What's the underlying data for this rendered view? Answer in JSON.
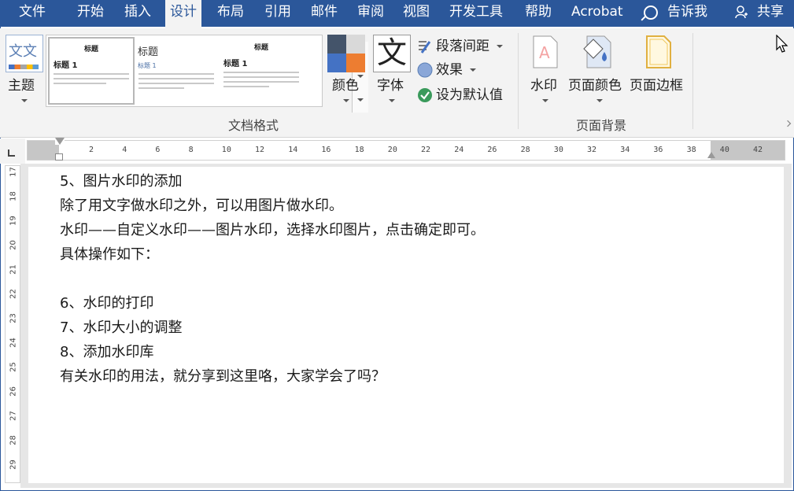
{
  "menubar": {
    "tabs": [
      "文件",
      "开始",
      "插入",
      "设计",
      "布局",
      "引用",
      "邮件",
      "审阅",
      "视图",
      "开发工具",
      "帮助",
      "Acrobat"
    ],
    "active_tab": "设计",
    "tell_me": "告诉我",
    "share": "共享"
  },
  "ribbon": {
    "themes": {
      "label": "主题",
      "icon_text": "文文"
    },
    "gallery": {
      "items": [
        {
          "heading": "标题",
          "title1": "标题 1"
        },
        {
          "big": "标题",
          "sub": "标题 1"
        },
        {
          "heading": "标题",
          "title1": "标题 1"
        }
      ]
    },
    "colors_label": "颜色",
    "font_label": "字体",
    "font_icon_text": "文",
    "paragraph_spacing": "段落间距",
    "effects": "效果",
    "set_default": "设为默认值",
    "document_formatting_group": "文档格式",
    "watermark": "水印",
    "page_color": "页面颜色",
    "page_borders": "页面边框",
    "page_background_group": "页面背景"
  },
  "ruler": {
    "h_ticks": [
      "2",
      "4",
      "6",
      "8",
      "10",
      "12",
      "14",
      "16",
      "18",
      "20",
      "22",
      "24",
      "26",
      "28",
      "30",
      "32",
      "34",
      "36",
      "38",
      "40",
      "42"
    ],
    "v_ticks": [
      "17",
      "18",
      "19",
      "20",
      "21",
      "22",
      "23",
      "24",
      "25",
      "26",
      "27",
      "28",
      "29"
    ]
  },
  "document": {
    "lines": [
      "5、图片水印的添加",
      "除了用文字做水印之外，可以用图片做水印。",
      "水印——自定义水印——图片水印，选择水印图片，点击确定即可。",
      "具体操作如下：",
      "",
      "6、水印的打印",
      "7、水印大小的调整",
      "8、添加水印库",
      "有关水印的用法，就分享到这里咯，大家学会了吗？"
    ]
  },
  "colors": {
    "accent": "#2b579a",
    "ribbon_bg": "#f3f3f3",
    "page_bg": "#ffffff"
  }
}
